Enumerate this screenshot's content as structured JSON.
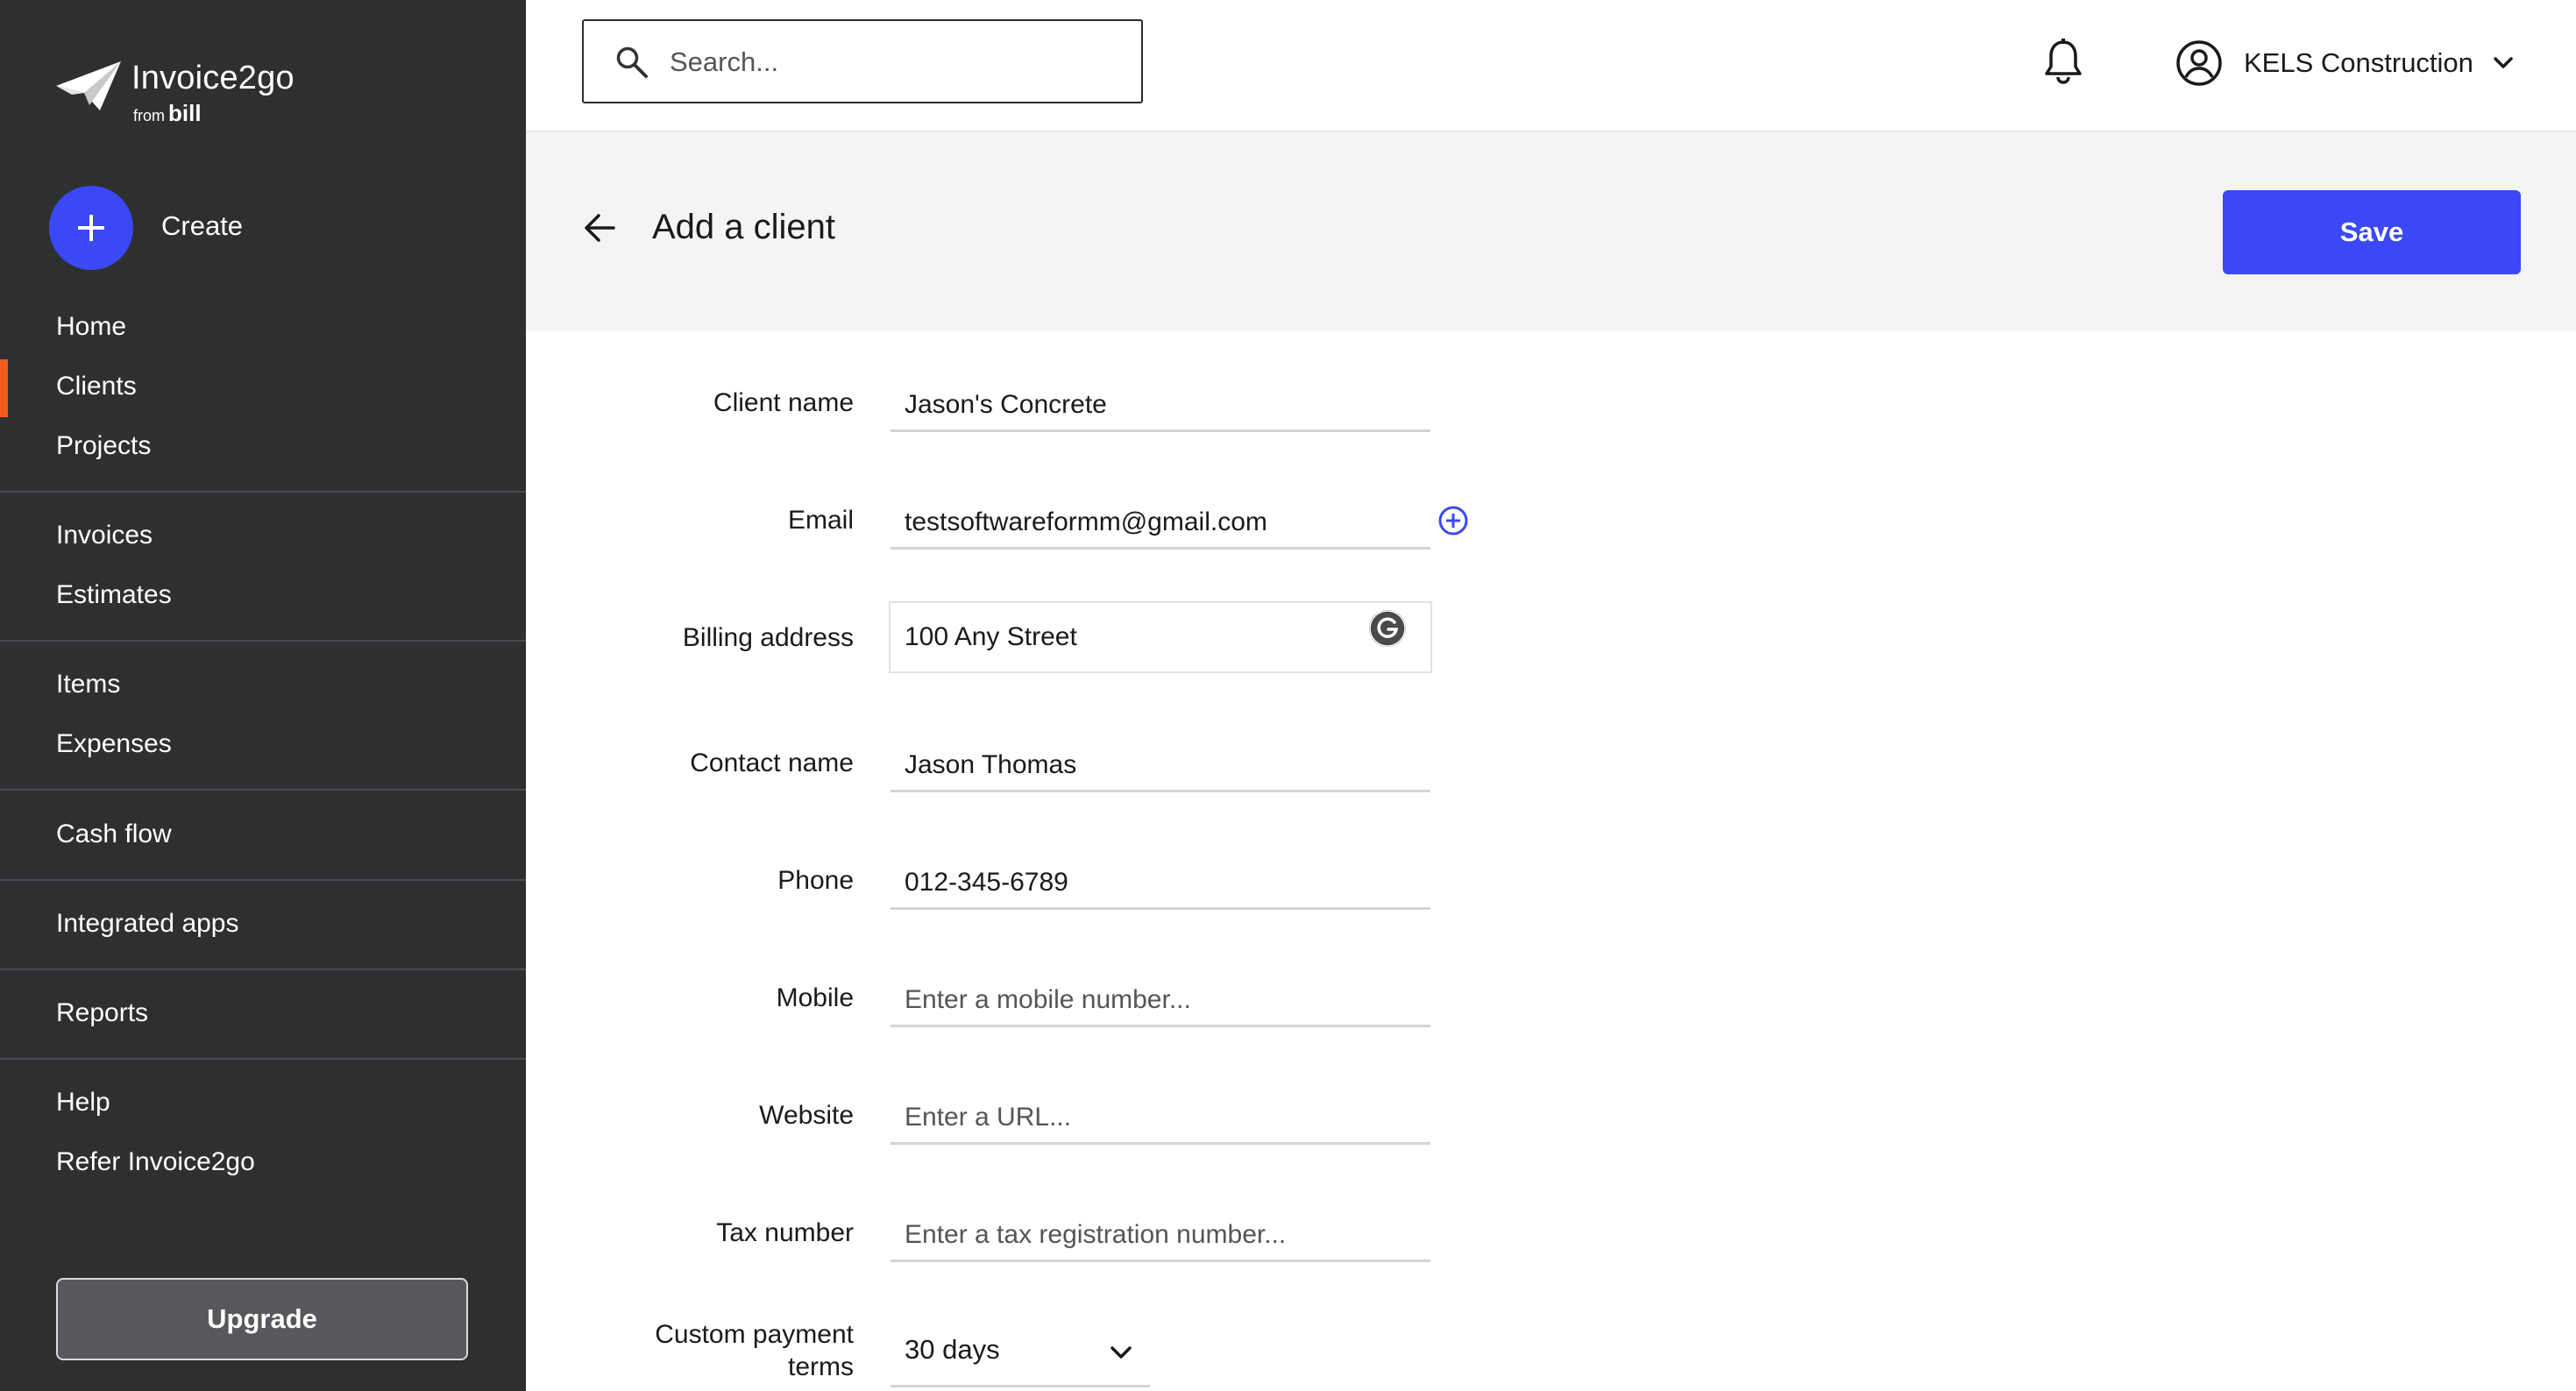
{
  "app": {
    "name": "Invoice2go",
    "from_text": "from",
    "from_brand": "bill"
  },
  "sidebar": {
    "create_label": "Create",
    "items": [
      {
        "label": "Home"
      },
      {
        "label": "Clients",
        "active": true
      },
      {
        "label": "Projects"
      },
      {
        "label": "Invoices"
      },
      {
        "label": "Estimates"
      },
      {
        "label": "Items"
      },
      {
        "label": "Expenses"
      },
      {
        "label": "Cash flow"
      },
      {
        "label": "Integrated apps"
      },
      {
        "label": "Reports"
      },
      {
        "label": "Help"
      },
      {
        "label": "Refer Invoice2go"
      }
    ],
    "upgrade_label": "Upgrade",
    "active_color": "#f25c1f"
  },
  "topbar": {
    "search_placeholder": "Search...",
    "account_name": "KELS Construction"
  },
  "page": {
    "title": "Add a client",
    "save_label": "Save"
  },
  "form": {
    "client_name": {
      "label": "Client name",
      "value": "Jason's Concrete",
      "placeholder": ""
    },
    "email": {
      "label": "Email",
      "value": "testsoftwareformm@gmail.com",
      "placeholder": ""
    },
    "billing_address": {
      "label": "Billing address",
      "value": "100 Any Street"
    },
    "contact_name": {
      "label": "Contact name",
      "value": "Jason Thomas",
      "placeholder": ""
    },
    "phone": {
      "label": "Phone",
      "value": "012-345-6789",
      "placeholder": ""
    },
    "mobile": {
      "label": "Mobile",
      "value": "",
      "placeholder": "Enter a mobile number..."
    },
    "website": {
      "label": "Website",
      "value": "",
      "placeholder": "Enter a URL..."
    },
    "tax_number": {
      "label": "Tax number",
      "value": "",
      "placeholder": "Enter a tax registration number..."
    },
    "payment_terms": {
      "label_line1": "Custom payment",
      "label_line2": "terms",
      "value": "30 days"
    }
  },
  "colors": {
    "sidebar_bg": "#2e2f31",
    "accent_blue": "#3a49f5",
    "page_header_bg": "#f4f4f4"
  }
}
